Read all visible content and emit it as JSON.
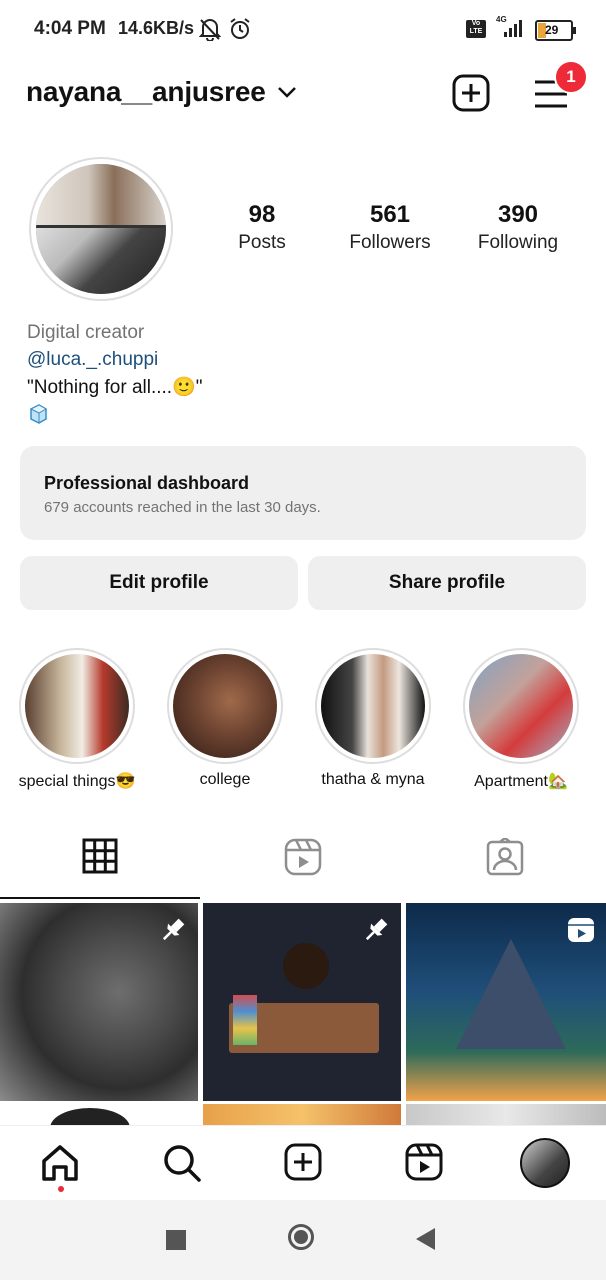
{
  "status_bar": {
    "time": "4:04 PM",
    "speed": "14.6KB/s",
    "network": "4G",
    "volte": "Vo LTE",
    "battery": "29"
  },
  "header": {
    "username": "nayana__anjusree",
    "notification_count": "1"
  },
  "profile": {
    "stats": [
      {
        "value": "98",
        "label": "Posts"
      },
      {
        "value": "561",
        "label": "Followers"
      },
      {
        "value": "390",
        "label": "Following"
      }
    ],
    "category": "Digital creator",
    "link": "@luca._.chuppi",
    "bio": "\"Nothing for all....🙂\""
  },
  "dashboard": {
    "title": "Professional dashboard",
    "subtitle": "679 accounts reached in the last 30 days."
  },
  "buttons": {
    "edit": "Edit profile",
    "share": "Share profile"
  },
  "highlights": [
    {
      "label": "special things😎"
    },
    {
      "label": "college"
    },
    {
      "label": "thatha & myna"
    },
    {
      "label": "Apartment🏡"
    }
  ],
  "colors": {
    "badge": "#ee2a38",
    "link": "#1d4f7c",
    "muted": "#737373",
    "button_bg": "#efefef"
  }
}
